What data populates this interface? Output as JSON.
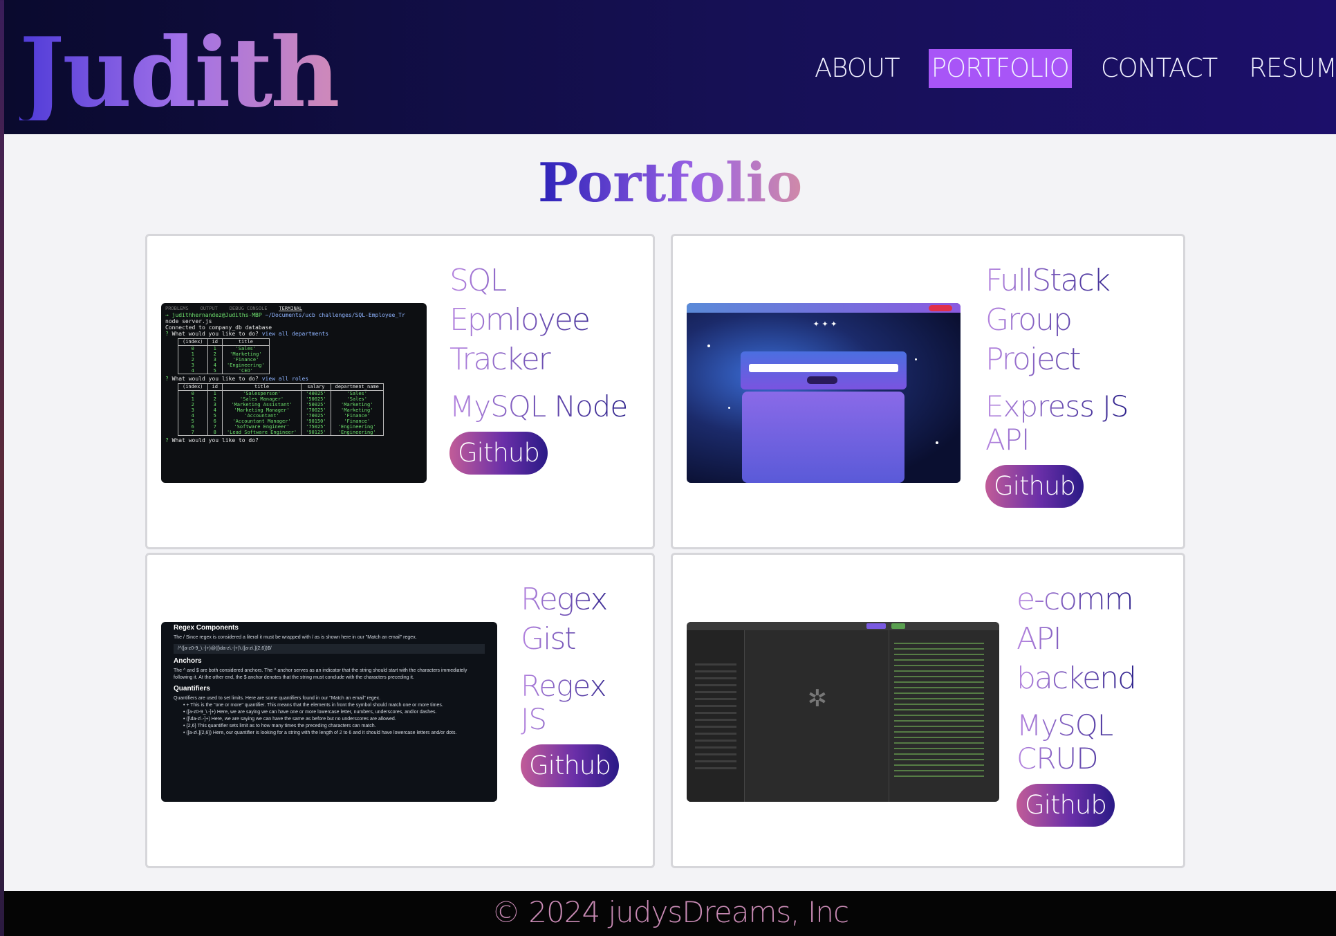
{
  "header": {
    "logo": "Judith",
    "nav": [
      {
        "label": "ABOUT",
        "active": false
      },
      {
        "label": "PORTFOLIO",
        "active": true
      },
      {
        "label": "CONTACT",
        "active": false
      },
      {
        "label": "RESUME",
        "active": false
      }
    ]
  },
  "page_title": "Portfolio",
  "projects": [
    {
      "title": "SQL\nEpmloyee\nTracker",
      "tech": "MySQL Node",
      "button": "Github",
      "screenshot": "terminal-output"
    },
    {
      "title": "FullStack\nGroup\nProject",
      "tech": "Express JS\nAPI",
      "button": "Github",
      "screenshot": "music-encyclopedia-app"
    },
    {
      "title": "Regex\nGist",
      "tech": "Regex\nJS",
      "button": "Github",
      "screenshot": "regex-gist-doc"
    },
    {
      "title": "e-comm\nAPI\nbackend",
      "tech": "MySQL\nCRUD",
      "button": "Github",
      "screenshot": "api-client"
    }
  ],
  "footer": {
    "text": "© 2024 judysDreams, Inc"
  },
  "colors": {
    "header_bg": "#161055",
    "nav_active": "#a855f7",
    "card_bg": "#ffffff",
    "page_bg": "#f3f3f6",
    "footer_bg": "#050505",
    "footer_text": "#c88ab4"
  }
}
